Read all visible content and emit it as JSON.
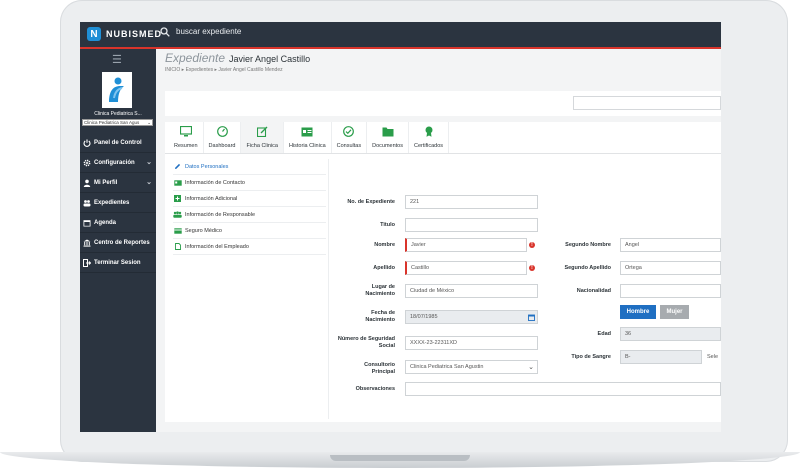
{
  "app": {
    "brand": "NUBISMED",
    "logo_letter": "N"
  },
  "search": {
    "placeholder": "buscar expediente"
  },
  "sidebar": {
    "clinic_name": "Clinica Pediatrica S...",
    "clinic_select": "Clinica Pediatrica San Agus",
    "items": [
      {
        "label": "Panel de Control",
        "icon": "power-icon"
      },
      {
        "label": "Configuración",
        "icon": "gear-icon"
      },
      {
        "label": "Mi Perfil",
        "icon": "user-icon"
      },
      {
        "label": "Expedientes",
        "icon": "users-icon"
      },
      {
        "label": "Agenda",
        "icon": "calendar-icon"
      },
      {
        "label": "Centro de Reportes",
        "icon": "bank-icon"
      },
      {
        "label": "Terminar Sesion",
        "icon": "logout-icon"
      }
    ]
  },
  "header": {
    "module": "Expediente",
    "patient": "Javier Angel Castillo",
    "breadcrumb": [
      "INICIO",
      "Expedientes",
      "Javier Angel Castillo Mendez"
    ]
  },
  "tabs": [
    {
      "label": "Resumen",
      "icon": "monitor-icon"
    },
    {
      "label": "Dashboard",
      "icon": "dashboard-icon"
    },
    {
      "label": "Ficha Clinica",
      "icon": "edit-icon"
    },
    {
      "label": "Historia Clinica",
      "icon": "history-icon"
    },
    {
      "label": "Consultas",
      "icon": "check-circle-icon"
    },
    {
      "label": "Documentos",
      "icon": "folder-icon"
    },
    {
      "label": "Certificados",
      "icon": "award-icon"
    }
  ],
  "subnav": [
    {
      "label": "Datos Personales",
      "icon": "pencil-icon"
    },
    {
      "label": "Información de Contacto",
      "icon": "id-card-icon"
    },
    {
      "label": "Información Adicional",
      "icon": "plus-square-icon"
    },
    {
      "label": "Información de Responsable",
      "icon": "group-icon"
    },
    {
      "label": "Seguro Médico",
      "icon": "card-icon"
    },
    {
      "label": "Información del Empleado",
      "icon": "document-icon"
    }
  ],
  "form": {
    "no_expediente": {
      "label": "No. de Expediente",
      "value": "221"
    },
    "titulo": {
      "label": "Titulo",
      "value": ""
    },
    "nombre": {
      "label": "Nombre",
      "value": "Javier"
    },
    "apellido": {
      "label": "Apellido",
      "value": "Castillo"
    },
    "lugar_nacimiento": {
      "label": "Lugar de Nacimiento",
      "value": "Ciudad de México"
    },
    "fecha_nacimiento": {
      "label": "Fecha de Nacimiento",
      "value": "18/07/1985"
    },
    "nss": {
      "label": "Número de Seguridad Social",
      "value": "XXXX-23-22311XD"
    },
    "consultorio": {
      "label": "Consultorio Principal",
      "value": "Clinica Pediatrica San Agustin"
    },
    "observaciones": {
      "label": "Observaciones",
      "value": ""
    },
    "segundo_nombre": {
      "label": "Segundo Nombre",
      "value": "Angel"
    },
    "segundo_apellido": {
      "label": "Segundo Apellido",
      "value": "Ortega"
    },
    "nacionalidad": {
      "label": "Nacionalidad",
      "value": ""
    },
    "sexo": {
      "hombre": "Hombre",
      "mujer": "Mujer"
    },
    "edad": {
      "label": "Edad",
      "value": "36"
    },
    "tipo_sangre": {
      "label": "Tipo de Sangre",
      "value": "B-",
      "select_label": "Sele"
    }
  },
  "colors": {
    "brand": "#1f8fd6",
    "dark": "#2b3440",
    "accent": "#d9342b",
    "primary_btn": "#1f6fc2"
  }
}
